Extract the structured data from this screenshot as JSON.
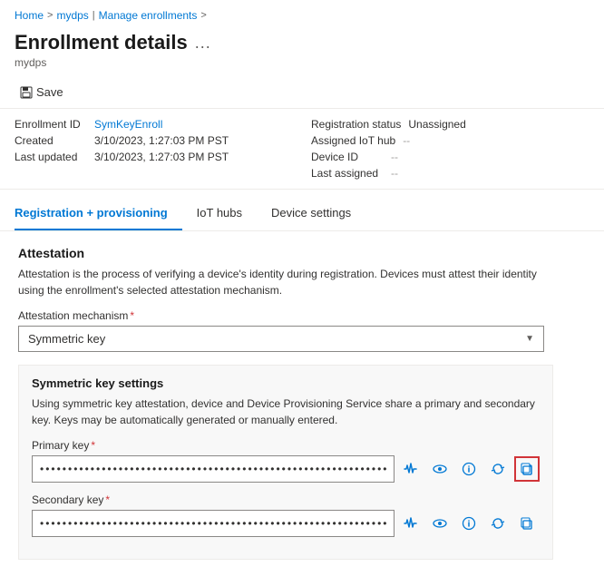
{
  "breadcrumb": {
    "home": "Home",
    "separator1": ">",
    "mydps": "mydps",
    "pipe": "|",
    "manage": "Manage enrollments",
    "separator2": ">"
  },
  "page": {
    "title": "Enrollment details",
    "ellipsis": "...",
    "subtitle": "mydps"
  },
  "toolbar": {
    "save_label": "Save"
  },
  "details": {
    "left": [
      {
        "label": "Enrollment ID",
        "value": "SymKeyEnroll",
        "type": "link"
      },
      {
        "label": "Created",
        "value": "3/10/2023, 1:27:03 PM PST",
        "type": "plain"
      },
      {
        "label": "Last updated",
        "value": "3/10/2023, 1:27:03 PM PST",
        "type": "plain"
      }
    ],
    "right": [
      {
        "label": "Registration status",
        "value": "Unassigned",
        "type": "plain"
      },
      {
        "label": "Assigned IoT hub",
        "value": "--",
        "type": "muted"
      },
      {
        "label": "Device ID",
        "value": "--",
        "type": "muted"
      },
      {
        "label": "Last assigned",
        "value": "--",
        "type": "muted"
      }
    ]
  },
  "tabs": [
    {
      "label": "Registration + provisioning",
      "active": true
    },
    {
      "label": "IoT hubs",
      "active": false
    },
    {
      "label": "Device settings",
      "active": false
    }
  ],
  "attestation": {
    "title": "Attestation",
    "description": "Attestation is the process of verifying a device's identity during registration. Devices must attest their identity using the enrollment's selected attestation mechanism.",
    "mechanism_label": "Attestation mechanism",
    "mechanism_required": "*",
    "mechanism_value": "Symmetric key"
  },
  "symmetric_key": {
    "title": "Symmetric key settings",
    "description": "Using symmetric key attestation, device and Device Provisioning Service share a primary and secondary key. Keys may be automatically generated or manually entered.",
    "primary_label": "Primary key",
    "primary_required": "*",
    "primary_value": "••••••••••••••••••••••••••••••••••••••••••••••••••••••••••••••••••••••••••",
    "secondary_label": "Secondary key",
    "secondary_required": "*",
    "secondary_value": "••••••••••••••••••••••••••••••••••••••••••••••••••••••••••••••••••••••••••"
  }
}
